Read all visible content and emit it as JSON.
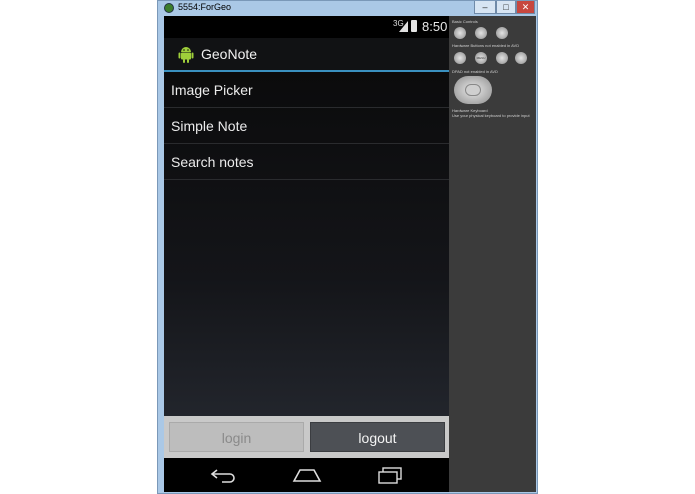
{
  "window": {
    "title": "5554:ForGeo",
    "controls": {
      "minimize": "–",
      "maximize": "□",
      "close": "✕"
    }
  },
  "status_bar": {
    "network": "3G",
    "time": "8:50"
  },
  "action_bar": {
    "app_title": "GeoNote",
    "icon": "android-robot-icon"
  },
  "menu": {
    "items": [
      {
        "label": "Image Picker"
      },
      {
        "label": "Simple Note"
      },
      {
        "label": "Search notes"
      }
    ]
  },
  "buttons": {
    "login": "login",
    "logout": "logout"
  },
  "nav_icons": [
    "back-icon",
    "home-icon",
    "recent-apps-icon"
  ],
  "side_panel": {
    "basic_controls": "Basic Controls",
    "hardware_buttons": "Hardware Buttons",
    "hardware_buttons_note": "not enabled in AVD",
    "dpad": "DPAD",
    "dpad_note": "not enabled in AVD",
    "hardware_keyboard": "Hardware Keyboard",
    "hardware_keyboard_note": "Use your physical keyboard to provide input",
    "menu_button": "MENU"
  },
  "colors": {
    "accent": "#3a90bf",
    "window_frame": "#aac8e6"
  }
}
